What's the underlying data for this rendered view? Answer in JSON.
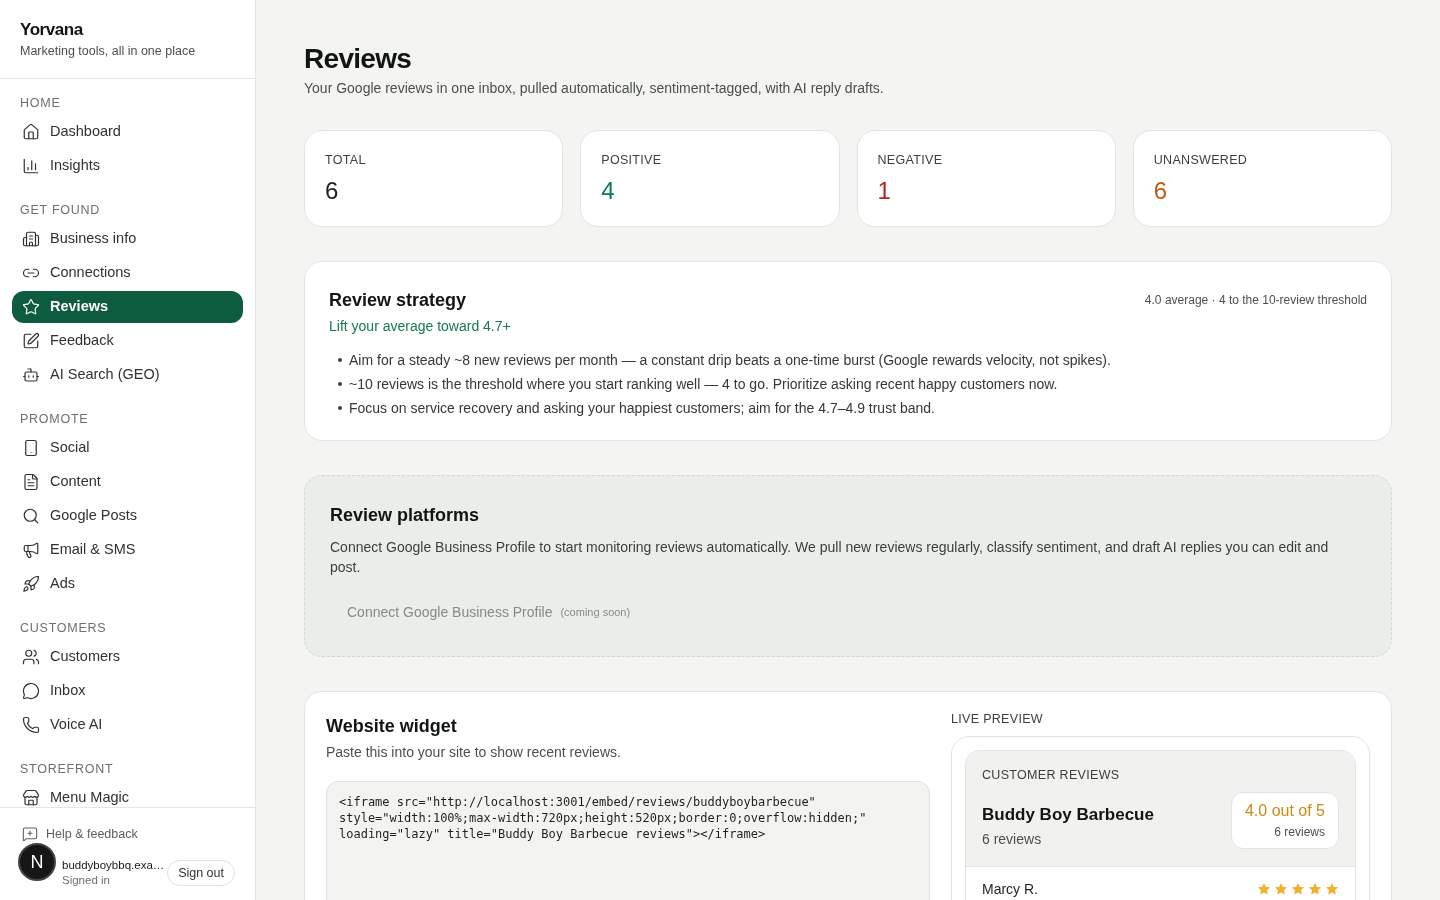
{
  "sidebar": {
    "brand": "Yorvana",
    "tagline": "Marketing tools, all in one place",
    "sections": [
      {
        "label": "HOME",
        "items": [
          {
            "label": "Dashboard",
            "selected": false
          },
          {
            "label": "Insights",
            "selected": false
          }
        ]
      },
      {
        "label": "GET FOUND",
        "items": [
          {
            "label": "Business info",
            "selected": false
          },
          {
            "label": "Connections",
            "selected": false
          },
          {
            "label": "Reviews",
            "selected": true
          },
          {
            "label": "Feedback",
            "selected": false
          },
          {
            "label": "AI Search (GEO)",
            "selected": false
          }
        ]
      },
      {
        "label": "PROMOTE",
        "items": [
          {
            "label": "Social",
            "selected": false
          },
          {
            "label": "Content",
            "selected": false
          },
          {
            "label": "Google Posts",
            "selected": false
          },
          {
            "label": "Email & SMS",
            "selected": false
          },
          {
            "label": "Ads",
            "selected": false
          }
        ]
      },
      {
        "label": "CUSTOMERS",
        "items": [
          {
            "label": "Customers",
            "selected": false
          },
          {
            "label": "Inbox",
            "selected": false
          },
          {
            "label": "Voice AI",
            "selected": false
          }
        ]
      },
      {
        "label": "STOREFRONT",
        "items": [
          {
            "label": "Menu Magic",
            "selected": false
          }
        ]
      }
    ],
    "footer": {
      "help": "Help & feedback",
      "user_email": "buddyboybbq.exa…",
      "user_status": "Signed in",
      "sign_out": "Sign out"
    }
  },
  "dev_badge": {
    "label": "N"
  },
  "page": {
    "title": "Reviews",
    "subtitle": "Your Google reviews in one inbox, pulled automatically, sentiment-tagged, with AI reply drafts."
  },
  "stats": [
    {
      "label": "TOTAL",
      "value": "6",
      "color": "#1c221e"
    },
    {
      "label": "POSITIVE",
      "value": "4",
      "color": "#0f7a4c"
    },
    {
      "label": "NEGATIVE",
      "value": "1",
      "color": "#b4231b"
    },
    {
      "label": "UNANSWERED",
      "value": "6",
      "color": "#bf5a0f"
    }
  ],
  "strategy": {
    "title": "Review strategy",
    "meta": "4.0 average · 4 to the 10-review threshold",
    "goal": "Lift your average toward 4.7+",
    "bullets": [
      "Aim for a steady ~8 new reviews per month — a constant drip beats a one-time burst (Google rewards velocity, not spikes).",
      "~10 reviews is the threshold where you start ranking well — 4 to go. Prioritize asking recent happy customers now.",
      "Focus on service recovery and asking your happiest customers; aim for the 4.7–4.9 trust band."
    ]
  },
  "platforms": {
    "title": "Review platforms",
    "description": "Connect Google Business Profile to start monitoring reviews automatically. We pull new reviews regularly, classify sentiment, and draft AI replies you can edit and post.",
    "connect_button": {
      "label": "Connect Google Business Profile",
      "note": "(coming soon)",
      "disabled": true
    }
  },
  "widget": {
    "title": "Website widget",
    "description": "Paste this into your site to show recent reviews.",
    "code": "<iframe src=\"http://localhost:3001/embed/reviews/buddyboybarbecue\"\nstyle=\"width:100%;max-width:720px;height:520px;border:0;overflow:hidden;\"\nloading=\"lazy\" title=\"Buddy Boy Barbecue reviews\"></iframe>",
    "preview": {
      "label": "LIVE PREVIEW",
      "eyebrow": "CUSTOMER REVIEWS",
      "business": "Buddy Boy Barbecue",
      "count": "6 reviews",
      "rating": "4.0 out of 5",
      "rating_count": "6 reviews",
      "reviews": [
        {
          "author": "Marcy R.",
          "stars": 5
        }
      ]
    }
  }
}
